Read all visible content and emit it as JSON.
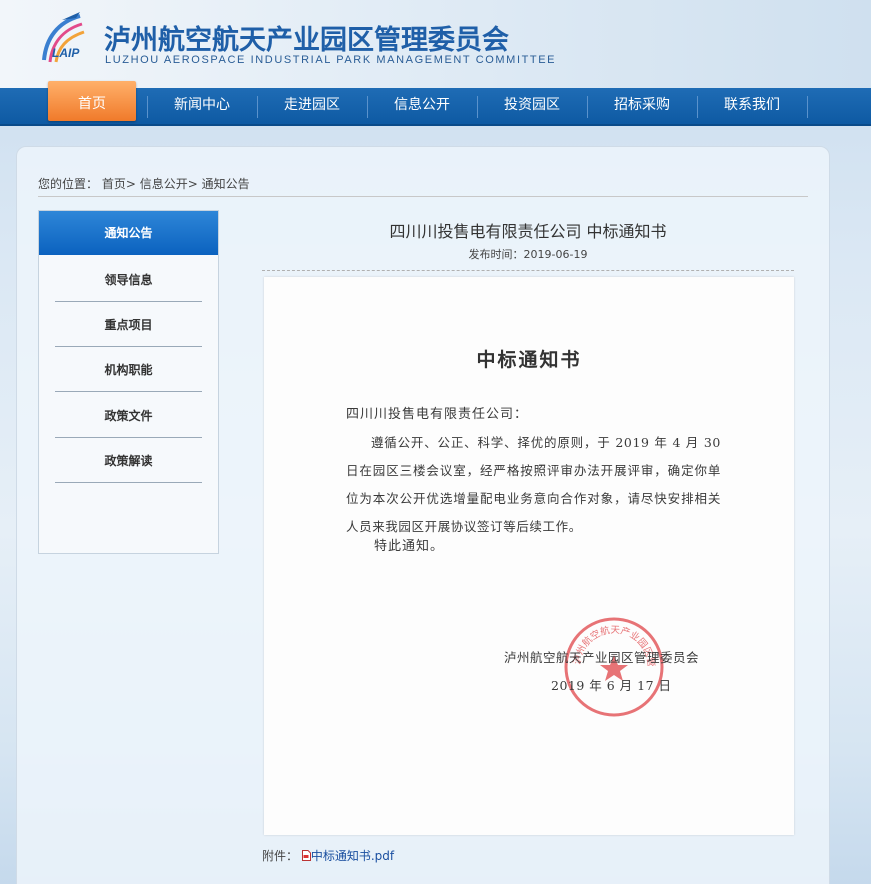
{
  "header": {
    "title": "泸州航空航天产业园区管理委员会",
    "subtitle": "LUZHOU AEROSPACE INDUSTRIAL PARK MANAGEMENT COMMITTEE",
    "logo_text": "LAIP"
  },
  "nav": {
    "items": [
      {
        "label": "首页",
        "active": true
      },
      {
        "label": "新闻中心"
      },
      {
        "label": "走进园区"
      },
      {
        "label": "信息公开"
      },
      {
        "label": "投资园区"
      },
      {
        "label": "招标采购"
      },
      {
        "label": "联系我们"
      }
    ]
  },
  "breadcrumb": {
    "prefix": "您的位置：",
    "items": [
      "首页",
      "信息公开",
      "通知公告"
    ],
    "separator": ">"
  },
  "sidebar": {
    "items": [
      {
        "label": "通知公告",
        "active": true
      },
      {
        "label": "领导信息"
      },
      {
        "label": "重点项目"
      },
      {
        "label": "机构职能"
      },
      {
        "label": "政策文件"
      },
      {
        "label": "政策解读"
      }
    ]
  },
  "article": {
    "title": "四川川投售电有限责任公司 中标通知书",
    "date_label": "发布时间：",
    "date": "2019-06-19"
  },
  "document": {
    "heading": "中标通知书",
    "addressee": "四川川投售电有限责任公司：",
    "body": "遵循公开、公正、科学、择优的原则，于 2019 年 4 月 30 日在园区三楼会议室，经严格按照评审办法开展评审，确定你单位为本次公开优选增量配电业务意向合作对象，请尽快安排相关人员来我园区开展协议签订等后续工作。",
    "closing": "特此通知。",
    "org": "泸州航空航天产业园区管理委员会",
    "sign_date": "2019 年 6 月 17 日",
    "seal_text": "泸州航空航天产业园区管理委员会",
    "seal_color": "#e0464a"
  },
  "attachment": {
    "label": "附件：",
    "file": "中标通知书.pdf"
  },
  "colors": {
    "nav_bg": "#0e5aa3",
    "nav_active": "#f07a2a",
    "sidebar_active": "#0b62bf",
    "title_blue": "#1f5fa8"
  }
}
